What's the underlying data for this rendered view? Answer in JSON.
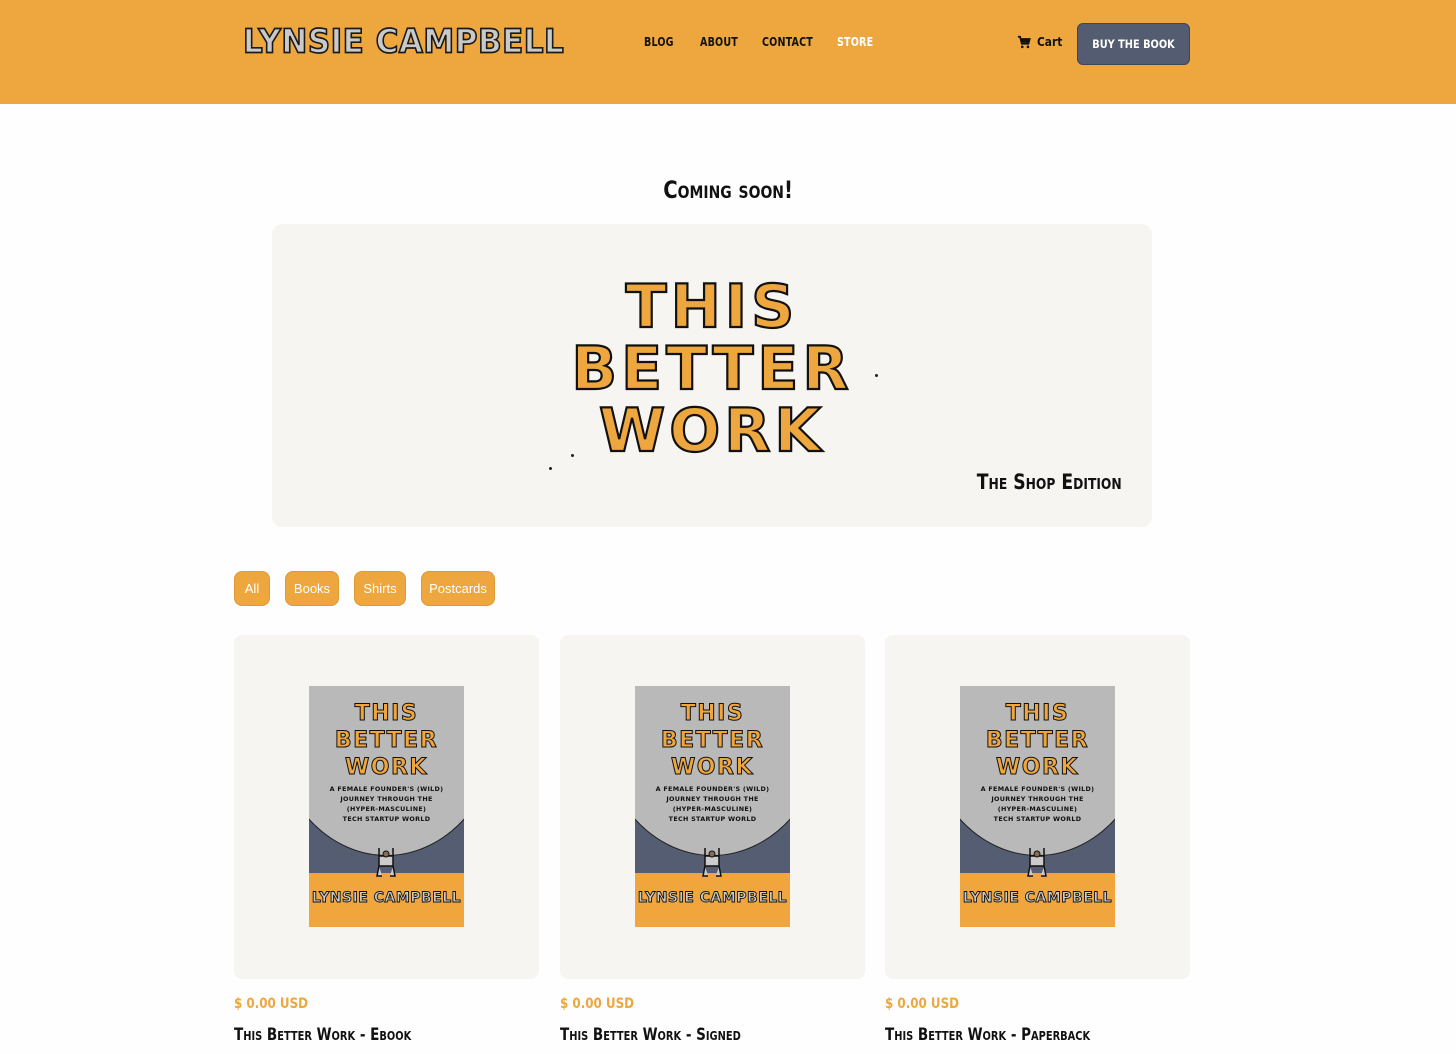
{
  "header": {
    "logo": "LYNSIE CAMPBELL",
    "nav": [
      {
        "label": "BLOG",
        "active": false
      },
      {
        "label": "ABOUT",
        "active": false
      },
      {
        "label": "CONTACT",
        "active": false
      },
      {
        "label": "STORE",
        "active": true
      }
    ],
    "cart_label": "Cart",
    "cart_icon": "cart-icon",
    "buy_button": "BUY THE BOOK"
  },
  "main": {
    "heading": "Coming soon!",
    "hero": {
      "title_lines": [
        "THIS",
        "BETTER",
        "WORK"
      ],
      "subtitle": "The Shop Edition"
    },
    "filters": [
      "All",
      "Books",
      "Shirts",
      "Postcards"
    ],
    "products": [
      {
        "price": "$ 0.00 USD",
        "name": "This Better Work - Ebook",
        "cover": {
          "title": "THIS BETTER WORK",
          "subtitle_lines": [
            "A FEMALE FOUNDER'S (WILD)",
            "JOURNEY THROUGH THE",
            "(HYPER-MASCULINE)",
            "TECH STARTUP WORLD"
          ],
          "author": "LYNSIE CAMPBELL"
        }
      },
      {
        "price": "$ 0.00 USD",
        "name": "This Better Work - Signed",
        "cover": {
          "title": "THIS BETTER WORK",
          "subtitle_lines": [
            "A FEMALE FOUNDER'S (WILD)",
            "JOURNEY THROUGH THE",
            "(HYPER-MASCULINE)",
            "TECH STARTUP WORLD"
          ],
          "author": "LYNSIE CAMPBELL"
        }
      },
      {
        "price": "$ 0.00 USD",
        "name": "This Better Work - Paperback",
        "cover": {
          "title": "THIS BETTER WORK",
          "subtitle_lines": [
            "A FEMALE FOUNDER'S (WILD)",
            "JOURNEY THROUGH THE",
            "(HYPER-MASCULINE)",
            "TECH STARTUP WORLD"
          ],
          "author": "LYNSIE CAMPBELL"
        }
      }
    ]
  },
  "colors": {
    "brand_orange": "#eea73e",
    "button_slate": "#535c71",
    "card_bg": "#f7f5f1",
    "text_dark": "#111111"
  }
}
